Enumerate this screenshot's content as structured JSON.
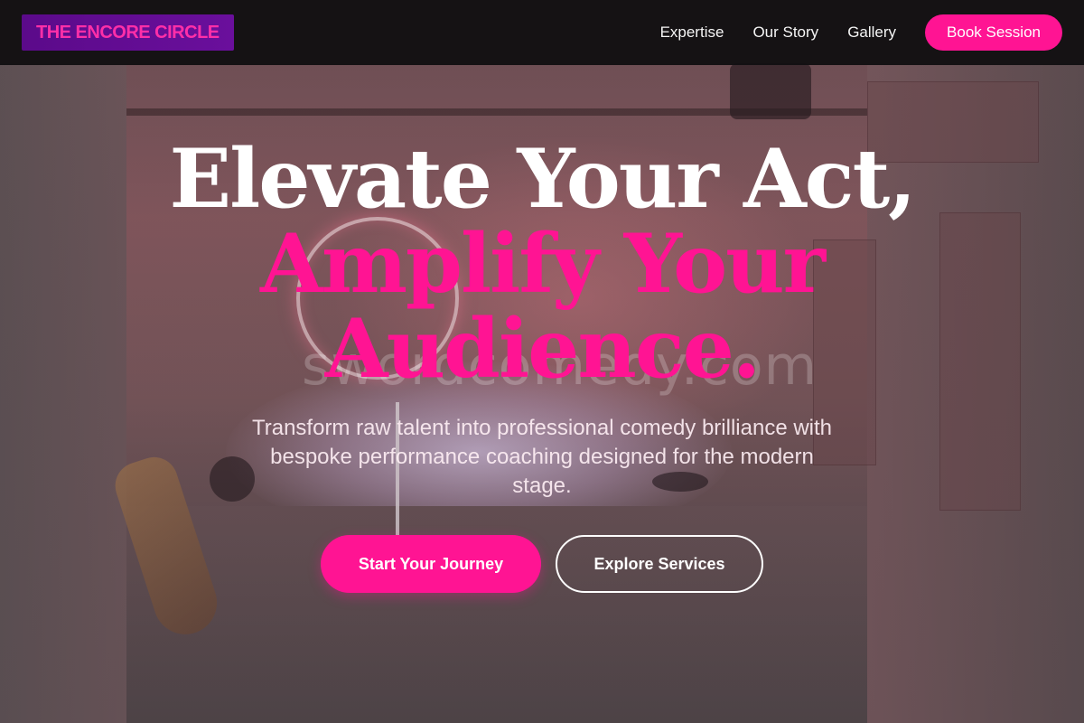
{
  "brand": {
    "logo_text": "THE ENCORE CIRCLE",
    "accent_color": "#ff1493",
    "logo_bg": "#5b0a8a"
  },
  "nav": {
    "links": [
      "Expertise",
      "Our Story",
      "Gallery"
    ],
    "cta_label": "Book Session"
  },
  "hero": {
    "headline_line1": "Elevate Your Act,",
    "headline_line2": "Amplify Your",
    "headline_line3": "Audience.",
    "subtitle": "Transform raw talent into professional comedy brilliance with bespoke performance coaching designed for the modern stage.",
    "primary_button": "Start Your Journey",
    "secondary_button": "Explore Services",
    "watermark": "swordcomedy.com"
  }
}
